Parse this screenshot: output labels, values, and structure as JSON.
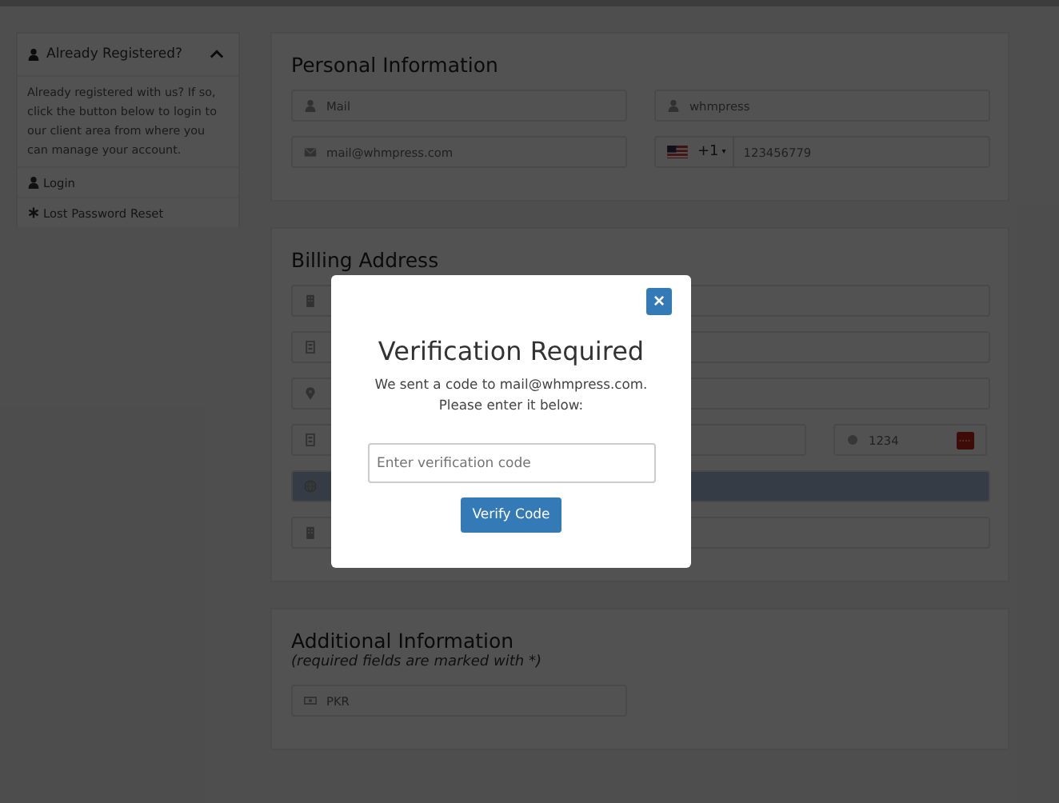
{
  "sidebar": {
    "title": "Already Registered?",
    "expanded": true,
    "text": "Already registered with us? If so, click the button below to login to our client area from where you can manage your account.",
    "links": [
      {
        "kind": "login",
        "label": "Login"
      },
      {
        "kind": "reset",
        "label": "Lost Password Reset"
      }
    ]
  },
  "personal": {
    "title": "Personal Information",
    "rows": [
      [
        {
          "kind": "name",
          "value": "Mail"
        },
        {
          "kind": "name",
          "value": "whmpress"
        }
      ],
      [
        {
          "kind": "email",
          "value": "mail@whmpress.com"
        },
        {
          "kind": "phone",
          "prefix": "+1",
          "caret": "▾",
          "value": "123456779"
        }
      ]
    ]
  },
  "billing": {
    "title": "Billing Address",
    "rows": [
      [
        {
          "kind": "company"
        }
      ],
      [
        {
          "kind": "address"
        }
      ],
      [
        {
          "kind": "city"
        }
      ],
      [
        {
          "kind": "address"
        },
        {
          "kind": "captcha",
          "value": "1234",
          "badge": true
        }
      ],
      [
        {
          "kind": "country",
          "disabled": true
        }
      ],
      [
        {
          "kind": "company"
        }
      ]
    ]
  },
  "additional": {
    "title": "Additional Information",
    "subtitle": "(required fields are marked with *)",
    "rows": [
      [
        {
          "kind": "currency",
          "value": "PKR"
        }
      ]
    ]
  },
  "modal": {
    "close": "×",
    "title": "Verification Required",
    "message": "We sent a code to mail@whmpress.com.",
    "message2": "Please enter it below:",
    "input": {
      "placeholder": "Enter verification code"
    },
    "button": "Verify Code"
  }
}
